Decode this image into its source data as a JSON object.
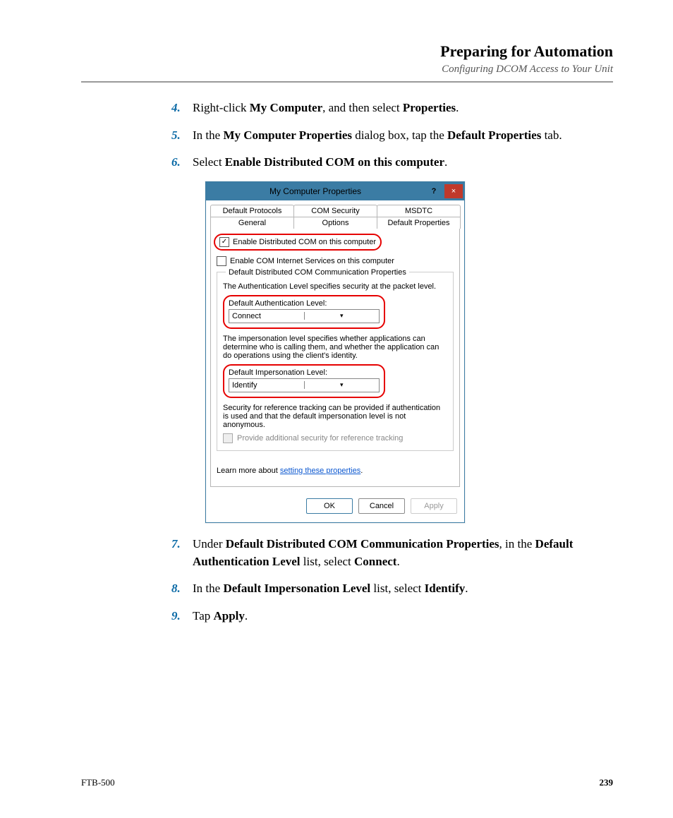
{
  "header": {
    "title": "Preparing for Automation",
    "subtitle": "Configuring DCOM Access to Your Unit"
  },
  "steps": {
    "s4": {
      "num": "4.",
      "t1": "Right-click ",
      "b1": "My Computer",
      "t2": ", and then select ",
      "b2": "Properties",
      "t3": "."
    },
    "s5": {
      "num": "5.",
      "t1": "In the ",
      "b1": "My Computer Properties",
      "t2": " dialog box, tap the ",
      "b2": "Default Properties",
      "t3": " tab."
    },
    "s6": {
      "num": "6.",
      "t1": "Select ",
      "b1": "Enable Distributed COM on this computer",
      "t2": "."
    },
    "s7": {
      "num": "7.",
      "t1": "Under ",
      "b1": "Default Distributed COM Communication Properties",
      "t2": ", in the ",
      "b2": "Default Authentication Level",
      "t3": " list, select ",
      "b3": "Connect",
      "t4": "."
    },
    "s8": {
      "num": "8.",
      "t1": "In the ",
      "b1": "Default Impersonation Level",
      "t2": " list, select ",
      "b2": "Identify",
      "t3": "."
    },
    "s9": {
      "num": "9.",
      "t1": "Tap ",
      "b1": "Apply",
      "t2": "."
    }
  },
  "dialog": {
    "title": "My Computer Properties",
    "help": "?",
    "close": "×",
    "tabs": {
      "top": [
        "Default Protocols",
        "COM Security",
        "MSDTC"
      ],
      "bottom": [
        "General",
        "Options",
        "Default Properties"
      ]
    },
    "enable_dcom": "Enable Distributed COM on this computer",
    "enable_inet": "Enable COM Internet Services on this computer",
    "group_title": "Default Distributed COM Communication Properties",
    "auth_desc": "The Authentication Level specifies security at the packet level.",
    "auth_label": "Default Authentication Level:",
    "auth_value": "Connect",
    "imp_desc": "The impersonation level specifies whether applications can determine who is calling them, and whether the application can do operations using the client's identity.",
    "imp_label": "Default Impersonation Level:",
    "imp_value": "Identify",
    "sec_desc": "Security for reference tracking can be provided if authentication is used and that the default impersonation level is not anonymous.",
    "sec_chk": "Provide additional security for reference tracking",
    "learn_prefix": "Learn more about ",
    "learn_link": "setting these properties",
    "learn_suffix": ".",
    "buttons": {
      "ok": "OK",
      "cancel": "Cancel",
      "apply": "Apply"
    }
  },
  "footer": {
    "product": "FTB-500",
    "page": "239"
  }
}
